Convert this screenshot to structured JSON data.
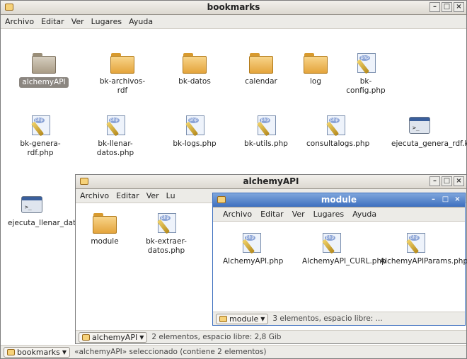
{
  "menu": [
    "Archivo",
    "Editar",
    "Ver",
    "Lugares",
    "Ayuda"
  ],
  "bookmarks_window": {
    "title": "bookmarks",
    "items": [
      {
        "label": "alchemyAPI",
        "type": "folder",
        "selected": true
      },
      {
        "label": "bk-archivos-rdf",
        "type": "folder"
      },
      {
        "label": "bk-datos",
        "type": "folder"
      },
      {
        "label": "calendar",
        "type": "folder"
      },
      {
        "label": "log",
        "type": "folder"
      },
      {
        "label": "bk-config.php",
        "type": "php"
      },
      {
        "label": "bk-genera-rdf.php",
        "type": "php"
      },
      {
        "label": "bk-llenar-datos.php",
        "type": "php"
      },
      {
        "label": "bk-logs.php",
        "type": "php"
      },
      {
        "label": "bk-utils.php",
        "type": "php"
      },
      {
        "label": "consultalogs.php",
        "type": "php"
      },
      {
        "label": "ejecuta_genera_rdf.ksh",
        "type": "script"
      },
      {
        "label": "ejecuta_llenar_datos.ksh",
        "type": "script"
      }
    ],
    "status_location": "bookmarks",
    "status_text": "«alchemyAPI» seleccionado (contiene 2 elementos)"
  },
  "alchemy_window": {
    "title": "alchemyAPI",
    "menu": [
      "Archivo",
      "Editar",
      "Ver",
      "Lu"
    ],
    "items": [
      {
        "label": "module",
        "type": "folder"
      },
      {
        "label": "bk-extraer-datos.php",
        "type": "php"
      }
    ],
    "status_location": "alchemyAPI",
    "status_text": "2 elementos, espacio libre: 2,8 Gib"
  },
  "module_window": {
    "title": "module",
    "items": [
      {
        "label": "AlchemyAPI.php",
        "type": "php"
      },
      {
        "label": "AlchemyAPI_CURL.php",
        "type": "php"
      },
      {
        "label": "AlchemyAPIParams.php",
        "type": "php"
      }
    ],
    "status_location": "module",
    "status_text": "3 elementos, espacio libre: ..."
  },
  "window_buttons": {
    "minimize": "–",
    "maximize": "□",
    "close": "×"
  },
  "accent_colors": {
    "active_title": "#3d6fbf",
    "folder": "#e4a43c",
    "selection": "#8b8680"
  }
}
